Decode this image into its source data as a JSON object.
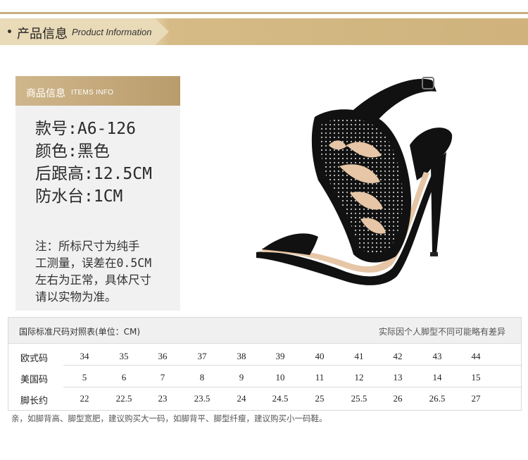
{
  "header": {
    "title_zh": "产品信息",
    "title_en": "Product Information"
  },
  "info": {
    "tab_zh": "商品信息",
    "tab_en": "ITEMS INFO",
    "specs": [
      "款号:A6-126",
      "颜色:黑色",
      "后跟高:12.5CM",
      "防水台:1CM"
    ],
    "note_lines": [
      "注：所标尺寸为纯手",
      "工测量，误差在0.5CM",
      "左右为正常，具体尺寸",
      "请以实物为准。"
    ]
  },
  "size_table": {
    "title": "国际标准尺码对照表(单位：CM)",
    "note": "实际因个人脚型不同可能略有差异",
    "rows": [
      {
        "label": "欧式码",
        "values": [
          "34",
          "35",
          "36",
          "37",
          "38",
          "39",
          "40",
          "41",
          "42",
          "43",
          "44"
        ]
      },
      {
        "label": "美国码",
        "values": [
          "5",
          "6",
          "7",
          "8",
          "9",
          "10",
          "11",
          "12",
          "13",
          "14",
          "15"
        ]
      },
      {
        "label": "脚长约",
        "values": [
          "22",
          "22.5",
          "23",
          "23.5",
          "24",
          "24.5",
          "25",
          "25.5",
          "26",
          "26.5",
          "27"
        ]
      }
    ]
  },
  "footnote": "亲，如脚背高、脚型宽肥，建议购买大一码，如脚背平、脚型纤瘦，建议购买小一码鞋。",
  "colors": {
    "accent": "#c9ae7e",
    "tab": "#bfa171",
    "panel": "#f1f1f1"
  }
}
